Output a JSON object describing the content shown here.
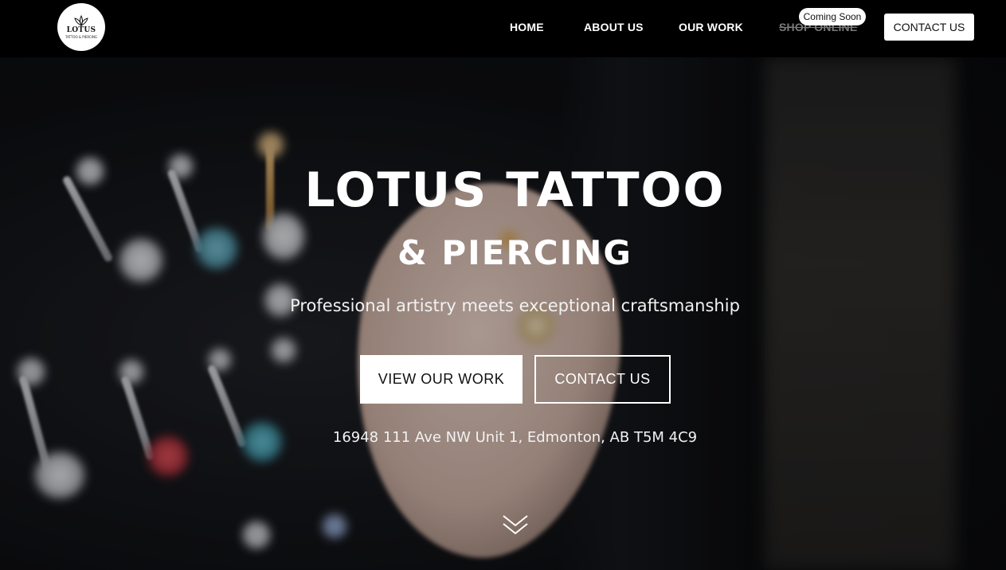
{
  "header": {
    "logo": {
      "text": "LOTUS",
      "subtext": "TATTOO & PIERCING"
    },
    "nav": [
      {
        "label": "HOME"
      },
      {
        "label": "ABOUT US"
      },
      {
        "label": "OUR WORK"
      },
      {
        "label": "SHOP ONLINE",
        "status": "disabled"
      }
    ],
    "badge": "Coming Soon",
    "contact_button": "CONTACT US"
  },
  "hero": {
    "title_line1": "LOTUS TATTOO",
    "title_line2": "& PIERCING",
    "tagline": "Professional artistry meets exceptional craftsmanship",
    "primary_button": "VIEW OUR WORK",
    "secondary_button": "CONTACT US",
    "address": "16948 111 Ave NW Unit 1, Edmonton, AB T5M 4C9",
    "scroll_icon": "chevron-double-down-icon"
  },
  "colors": {
    "header_bg": "#000000",
    "text": "#ffffff",
    "disabled_nav": "#7a7a7a",
    "button_bg": "#ffffff",
    "button_text": "#111111"
  }
}
